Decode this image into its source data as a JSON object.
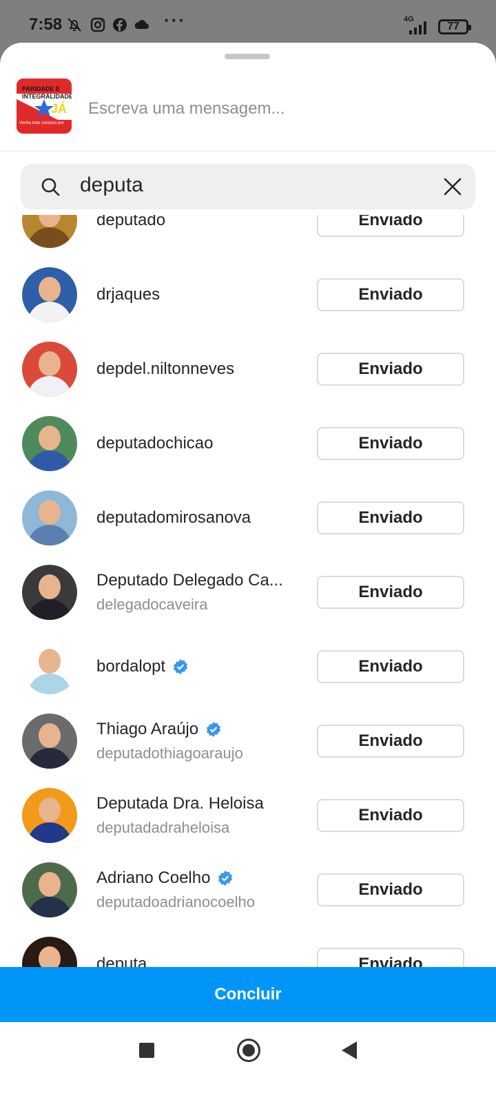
{
  "status": {
    "time": "7:58",
    "network": "4G",
    "battery": "77"
  },
  "compose": {
    "thumbnail_text_top": "PARIDADE E INTEGRALIDADE",
    "thumbnail_text_big": "JÁ",
    "thumbnail_text_small": "Venha lutar conosco por",
    "placeholder": "Escreva uma mensagem..."
  },
  "search": {
    "query": "deputa"
  },
  "results": [
    {
      "name": "deputado",
      "subtitle": "",
      "verified": false,
      "button": "Enviado",
      "bg": "#b8862f",
      "shirt": "#7a4e1c"
    },
    {
      "name": "drjaques",
      "subtitle": "",
      "verified": false,
      "button": "Enviado",
      "bg": "#2e5fa8",
      "shirt": "#f2f2f2"
    },
    {
      "name": "depdel.niltonneves",
      "subtitle": "",
      "verified": false,
      "button": "Enviado",
      "bg": "#d94a3a",
      "shirt": "#f0f0f5"
    },
    {
      "name": "deputadochicao",
      "subtitle": "",
      "verified": false,
      "button": "Enviado",
      "bg": "#4f8a5c",
      "shirt": "#2f5aa8"
    },
    {
      "name": "deputadomirosanova",
      "subtitle": "",
      "verified": false,
      "button": "Enviado",
      "bg": "#8fb7d8",
      "shirt": "#5b7fb0"
    },
    {
      "name": "Deputado Delegado Ca...",
      "subtitle": "delegadocaveira",
      "verified": false,
      "button": "Enviado",
      "bg": "#3a3a3a",
      "shirt": "#1f1f25"
    },
    {
      "name": "bordalopt",
      "subtitle": "",
      "verified": true,
      "button": "Enviado",
      "bg": "#ffffff",
      "shirt": "#a9d6e8"
    },
    {
      "name": "Thiago Araújo",
      "subtitle": "deputadothiagoaraujo",
      "verified": true,
      "button": "Enviado",
      "bg": "#6b6b6b",
      "shirt": "#262a3a"
    },
    {
      "name": "Deputada Dra. Heloisa",
      "subtitle": "deputadadraheloisa",
      "verified": false,
      "button": "Enviado",
      "bg": "#f39a1a",
      "shirt": "#1f3a8a"
    },
    {
      "name": "Adriano Coelho",
      "subtitle": "deputadoadrianocoelho",
      "verified": true,
      "button": "Enviado",
      "bg": "#4d6b4a",
      "shirt": "#23324a"
    },
    {
      "name": "deputa",
      "subtitle": "",
      "verified": false,
      "button": "Enviado",
      "bg": "#2a1a14",
      "shirt": "#e6c3a5"
    }
  ],
  "done_label": "Concluir",
  "colors": {
    "accent": "#0095f6",
    "verified": "#3897f0"
  }
}
